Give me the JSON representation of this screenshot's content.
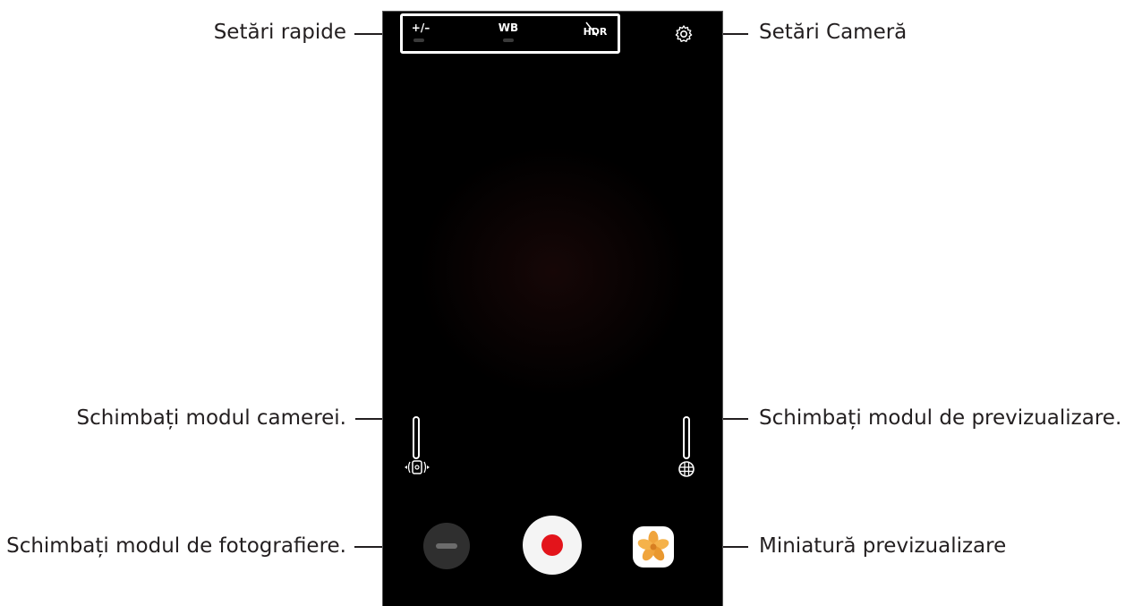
{
  "callouts": {
    "quick_settings": "Setări rapide",
    "camera_settings": "Setări Cameră",
    "switch_camera": "Schimbați modul camerei.",
    "preview_mode": "Schimbați modul de previzualizare.",
    "shooting_mode": "Schimbați modul de fotografiere.",
    "preview_thumbnail": "Miniatură previzualizare"
  },
  "quick_settings": {
    "exposure": "+/–",
    "white_balance": "WB",
    "hdr": "HDR"
  },
  "icons": {
    "settings": "gear-icon",
    "switch_camera": "switch-camera-icon",
    "preview_mode": "globe-grid-icon",
    "thumbnail": "flower-icon"
  },
  "colors": {
    "viewfinder": "#000000",
    "record_button": "#e3141b",
    "thumbnail_flower": "#f0a43c"
  }
}
